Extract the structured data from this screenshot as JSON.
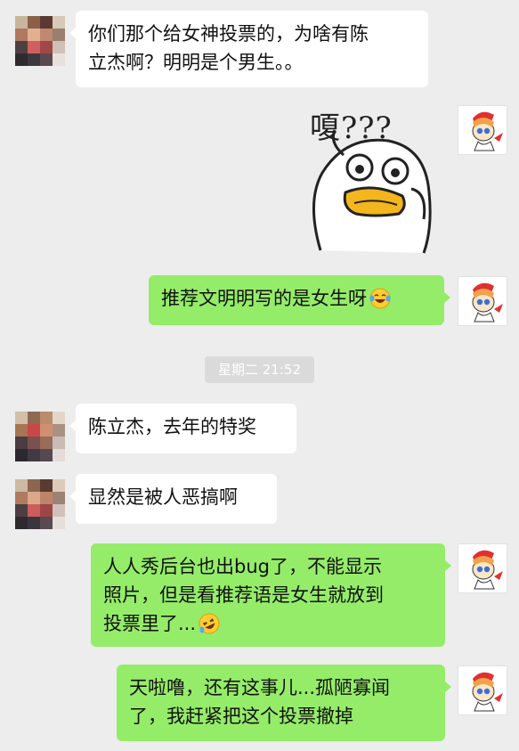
{
  "colors": {
    "background": "#ededed",
    "incoming_bubble": "#ffffff",
    "outgoing_bubble": "#95ec69",
    "timestamp_bg": "#dadada"
  },
  "messages": [
    {
      "sender": "other",
      "text": "你们那个给女神投票的，为啥有陈\n立杰啊？明明是个男生。。"
    },
    {
      "sender": "me",
      "type": "sticker",
      "sticker_text": "嗄???"
    },
    {
      "sender": "me",
      "text": "推荐文明明写的是女生呀",
      "emoji": "laughing-tears-emoji"
    },
    {
      "sender": "other",
      "text": "陈立杰，去年的特奖"
    },
    {
      "sender": "other",
      "text": "显然是被人恶搞啊"
    },
    {
      "sender": "me",
      "text": "人人秀后台也出bug了，不能显示\n照片，但是看推荐语是女生就放到\n投票里了...",
      "emoji": "rolling-laughing-emoji"
    },
    {
      "sender": "me",
      "text": "天啦噜，还有这事儿...孤陋寡闻\n了，我赶紧把这个投票撤掉"
    }
  ],
  "timestamp": "星期二 21:52"
}
